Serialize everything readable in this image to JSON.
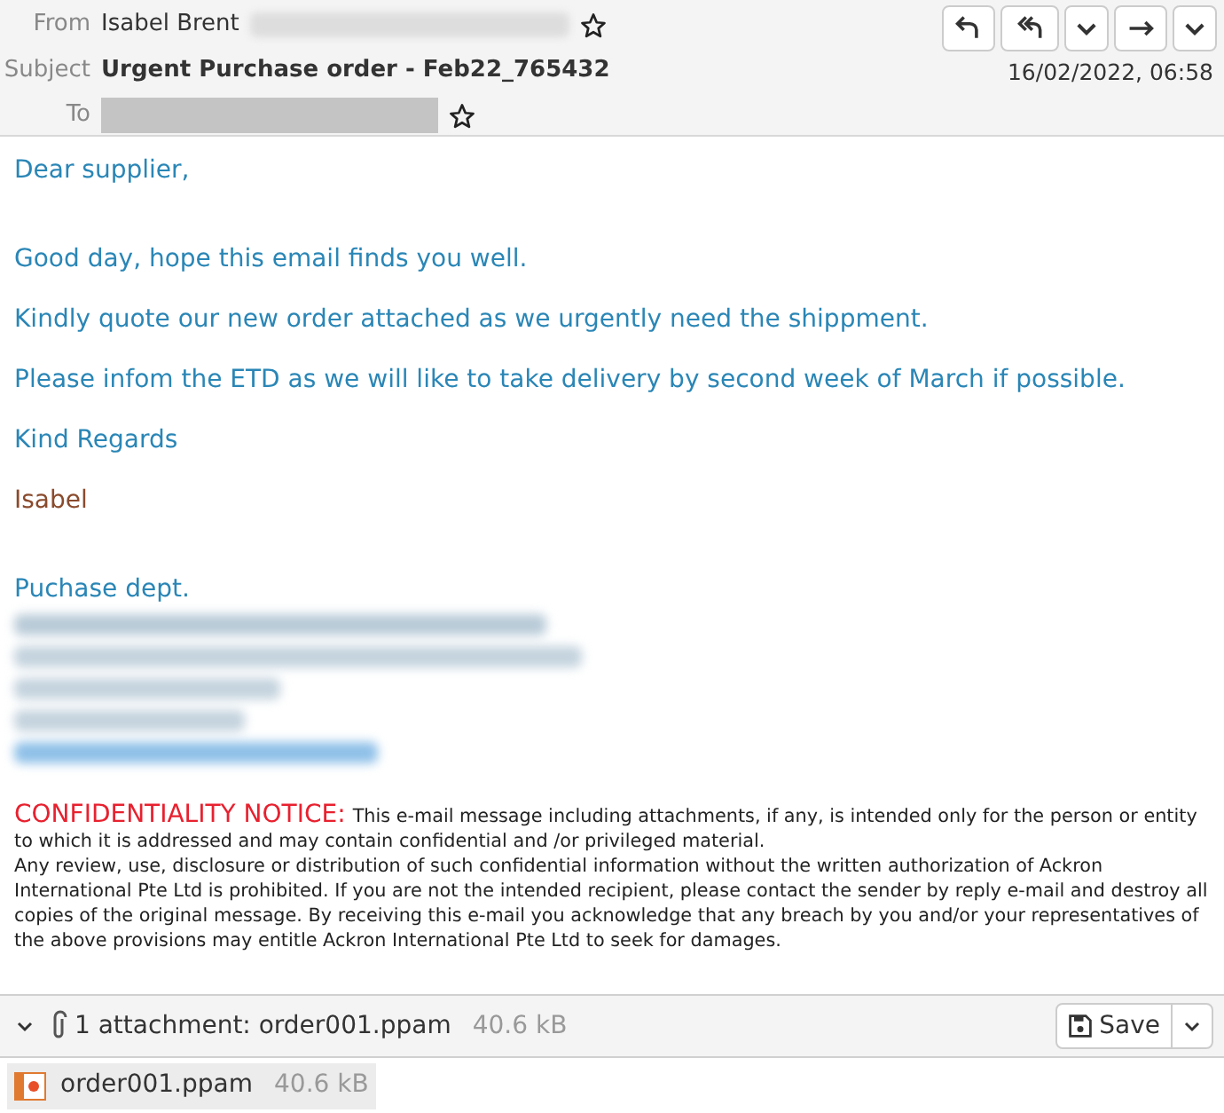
{
  "header": {
    "from_label": "From",
    "from_name": "Isabel Brent",
    "subject_label": "Subject",
    "subject": "Urgent Purchase order - Feb22_765432",
    "to_label": "To",
    "date": "16/02/2022, 06:58",
    "buttons": [
      {
        "kind": "reply"
      },
      {
        "kind": "reply-all"
      },
      {
        "kind": "menu"
      },
      {
        "kind": "forward"
      },
      {
        "kind": "menu"
      }
    ]
  },
  "body": [
    {
      "kind": "greeting",
      "text": "Dear supplier,"
    },
    {
      "kind": "line",
      "text": "Good day, hope this email finds you well."
    },
    {
      "kind": "line",
      "text": "Kindly quote our new order attached as we urgently need the shippment."
    },
    {
      "kind": "line",
      "text": "Please infom the ETD as we will like to take delivery by second week of March if possible."
    },
    {
      "kind": "line",
      "text": "Kind Regards"
    },
    {
      "kind": "name",
      "text": "Isabel"
    },
    {
      "kind": "dept",
      "text": "Puchase dept."
    }
  ],
  "notice": {
    "heading": "CONFIDENTIALITY NOTICE:",
    "paragraphs": [
      "This e-mail message including attachments, if any, is intended only for the person or entity to which it is addressed and may contain confidential and /or privileged material.",
      "Any review, use, disclosure or distribution of such confidential information without the written authorization of Ackron International Pte Ltd is prohibited. If you are not the intended recipient, please contact the sender by reply e-mail and destroy all copies of the original message. By receiving this e-mail you acknowledge that any breach by you and/or your representatives of the above provisions may entitle Ackron International Pte Ltd to seek for damages."
    ]
  },
  "attachments_bar": {
    "expanded": true,
    "summary": "1 attachment: order001.ppam",
    "size": "40.6 kB",
    "save_label": "Save"
  },
  "attachments": [
    {
      "name": "order001.ppam",
      "size": "40.6 kB"
    }
  ]
}
